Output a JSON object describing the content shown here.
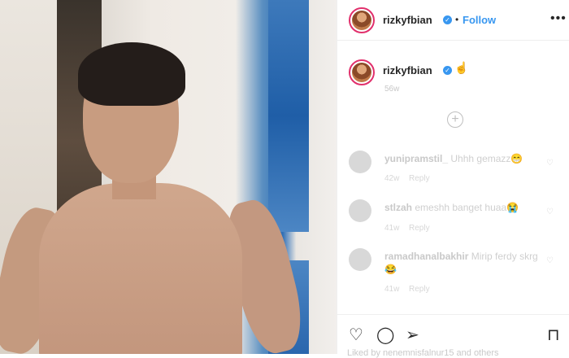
{
  "post": {
    "username": "rizkyfbian",
    "follow_label": "Follow",
    "separator": "•",
    "caption_emoji": "☝",
    "caption_time": "56w"
  },
  "comments": [
    {
      "user": "yunipramstil_",
      "text": "Uhhh gemazz😁",
      "time": "42w",
      "reply": "Reply"
    },
    {
      "user": "stlzah",
      "text": "emeshh banget huaa😭",
      "time": "41w",
      "reply": "Reply"
    },
    {
      "user": "ramadhanalbakhir",
      "text": "Mirip ferdy skrg 😂",
      "time": "41w",
      "reply": "Reply"
    }
  ],
  "footer": {
    "liked_by": "Liked by nenemnisfalnur15 and others"
  },
  "icons": {
    "verified": "verified-badge-icon",
    "more": "more-options-icon",
    "load_more": "load-more-icon",
    "like": "heart-icon",
    "comment": "comment-icon",
    "share": "share-icon",
    "save": "bookmark-icon"
  },
  "colors": {
    "accent": "#3897f0",
    "story_ring": "#e1306c",
    "text": "#262626",
    "muted": "#c7c7c7"
  }
}
